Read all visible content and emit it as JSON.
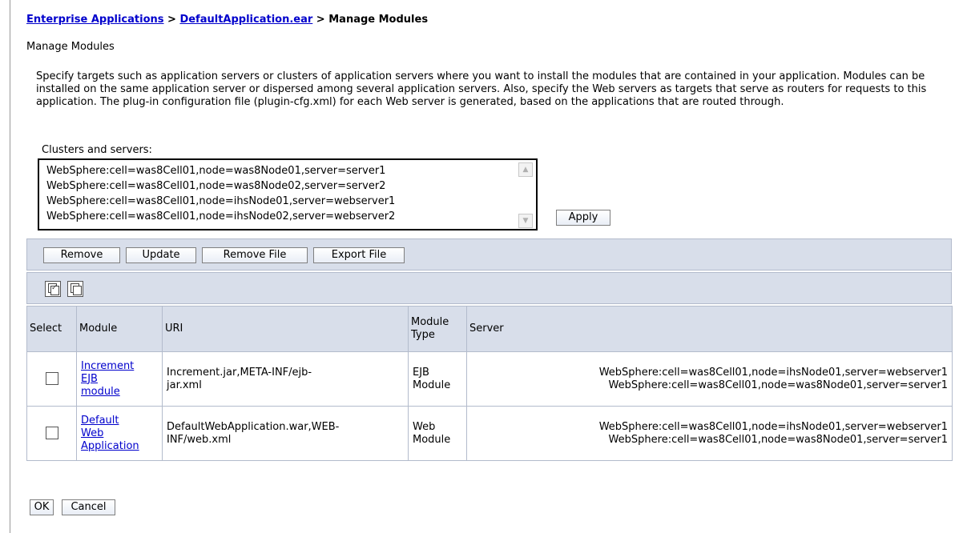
{
  "breadcrumb": {
    "link1": "Enterprise Applications",
    "sep1": " > ",
    "link2": "DefaultApplication.ear",
    "sep2": " > ",
    "current": "Manage Modules"
  },
  "page_subtitle": "Manage Modules",
  "description": "Specify targets such as application servers or clusters of application servers where you want to install the modules that are contained in your application. Modules can be installed on the same application server or dispersed among several application servers. Also, specify the Web servers as targets that serve as routers for requests to this application. The plug-in configuration file (plugin-cfg.xml) for each Web server is generated, based on the applications that are routed through.",
  "clusters_label": "Clusters and servers:",
  "clusters_options": [
    "WebSphere:cell=was8Cell01,node=was8Node01,server=server1",
    "WebSphere:cell=was8Cell01,node=was8Node02,server=server2",
    "WebSphere:cell=was8Cell01,node=ihsNode01,server=webserver1",
    "WebSphere:cell=was8Cell01,node=ihsNode02,server=webserver2"
  ],
  "apply_label": "Apply",
  "toolbar": {
    "remove": "Remove",
    "update": "Update",
    "remove_file": "Remove File",
    "export_file": "Export File"
  },
  "table": {
    "headers": {
      "select": "Select",
      "module": "Module",
      "uri": "URI",
      "module_type_line1": "Module",
      "module_type_line2": "Type",
      "server": "Server"
    },
    "rows": [
      {
        "module_lines": [
          "Increment",
          "EJB",
          "module"
        ],
        "uri_lines": [
          "Increment.jar,META-INF/ejb-",
          "jar.xml"
        ],
        "type_lines": [
          "EJB",
          "Module"
        ],
        "server_lines": [
          "WebSphere:cell=was8Cell01,node=ihsNode01,server=webserver1",
          "WebSphere:cell=was8Cell01,node=was8Node01,server=server1"
        ],
        "selected": false
      },
      {
        "module_lines": [
          "Default",
          "Web",
          "Application"
        ],
        "uri_lines": [
          "DefaultWebApplication.war,WEB-",
          "INF/web.xml"
        ],
        "type_lines": [
          "Web",
          "Module"
        ],
        "server_lines": [
          "WebSphere:cell=was8Cell01,node=ihsNode01,server=webserver1",
          "WebSphere:cell=was8Cell01,node=was8Node01,server=server1"
        ],
        "selected": false
      }
    ]
  },
  "ok_label": "OK",
  "cancel_label": "Cancel",
  "icons": {
    "select_all": "select-all-icon",
    "deselect_all": "deselect-all-icon"
  }
}
